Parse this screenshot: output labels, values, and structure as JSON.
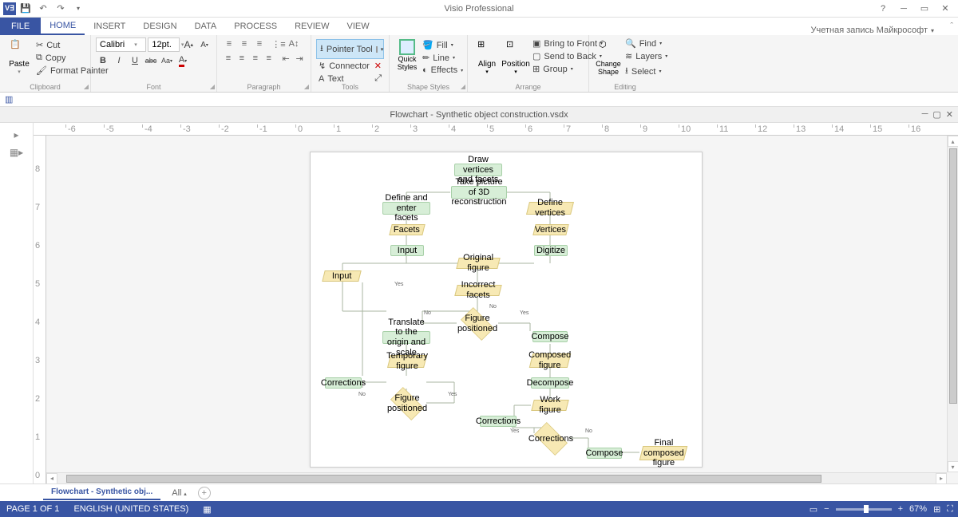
{
  "titlebar": {
    "app": "Visio Professional"
  },
  "tabs": {
    "file": "FILE",
    "home": "HOME",
    "insert": "INSERT",
    "design": "DESIGN",
    "data": "DATA",
    "process": "PROCESS",
    "review": "REVIEW",
    "view": "VIEW"
  },
  "account": "Учетная запись Майкрософт",
  "ribbon": {
    "clipboard": {
      "label": "Clipboard",
      "paste": "Paste",
      "cut": "Cut",
      "copy": "Copy",
      "painter": "Format Painter"
    },
    "font": {
      "label": "Font",
      "family": "Calibri",
      "size": "12pt."
    },
    "paragraph": {
      "label": "Paragraph"
    },
    "tools": {
      "label": "Tools",
      "pointer": "Pointer Tool",
      "connector": "Connector",
      "text": "Text"
    },
    "shapestyles": {
      "label": "Shape Styles",
      "quick": "Quick\nStyles",
      "fill": "Fill",
      "line": "Line",
      "effects": "Effects"
    },
    "arrange": {
      "label": "Arrange",
      "align": "Align",
      "position": "Position",
      "bringfront": "Bring to Front",
      "sendback": "Send to Back",
      "group": "Group"
    },
    "change": {
      "change": "Change\nShape"
    },
    "editing": {
      "label": "Editing",
      "find": "Find",
      "layers": "Layers",
      "select": "Select"
    }
  },
  "doc": {
    "title": "Flowchart - Synthetic object construction.vsdx"
  },
  "shapes": {
    "draw": "Draw vertices and facets",
    "take": "Take picture of 3D reconstruction",
    "defenter": "Define and enter facets",
    "defvert": "Define vertices",
    "facets": "Facets",
    "vertices": "Vertices",
    "input1": "Input",
    "digitize": "Digitize",
    "input2": "Input",
    "orig": "Original figure",
    "incorrect": "Incorrect facets",
    "figpos1": "Figure positioned",
    "translate": "Translate to the origin and scale",
    "compose1": "Compose",
    "tempfig": "Temporary figure",
    "compfig": "Composed figure",
    "corr1": "Corrections",
    "decompose": "Decompose",
    "figpos2": "Figure positioned",
    "workfig": "Work figure",
    "corr2": "Corrections",
    "corr3": "Corrections",
    "compose2": "Compose",
    "final": "Final composed figure"
  },
  "flowlabels": {
    "yes": "Yes",
    "no": "No"
  },
  "sheets": {
    "tab": "Flowchart - Synthetic obj...",
    "all": "All"
  },
  "status": {
    "page": "PAGE 1 OF 1",
    "lang": "ENGLISH (UNITED STATES)",
    "zoom": "67%"
  }
}
